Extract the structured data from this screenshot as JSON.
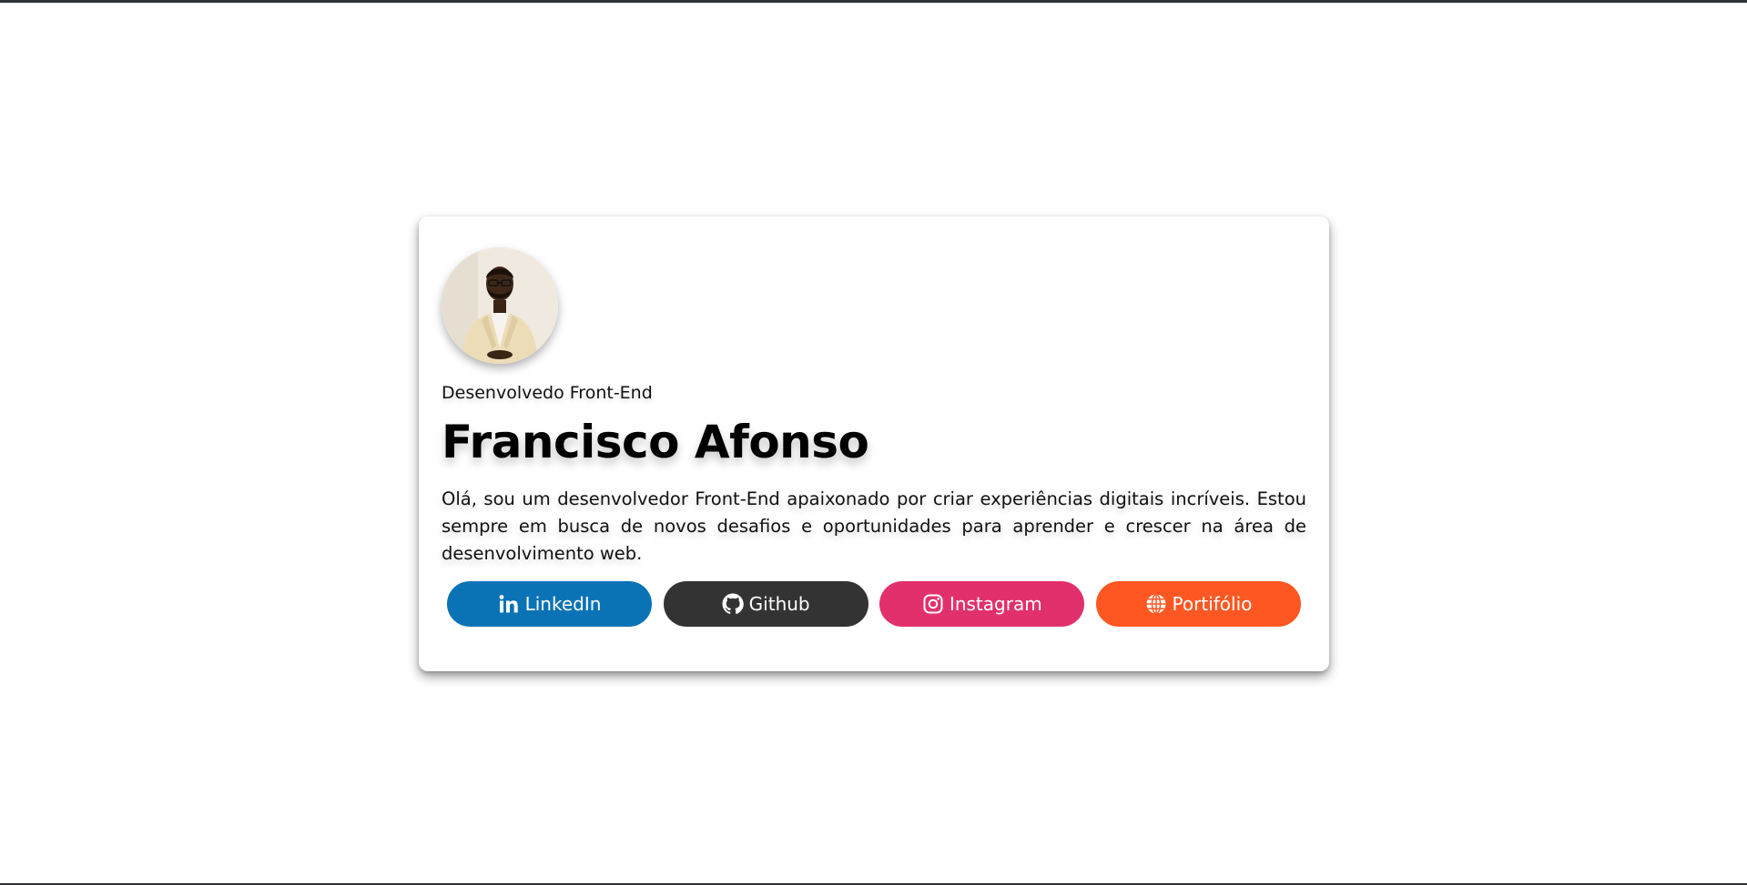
{
  "profile": {
    "role": "Desenvolvedo Front-End",
    "name": "Francisco Afonso",
    "bio": "Olá, sou um desenvolvedor Front-End apaixonado por criar experiências digitais incríveis. Estou sempre em busca de novos desafios e oportunidades para aprender e crescer na área de desenvolvimento web."
  },
  "links": [
    {
      "label": "LinkedIn",
      "icon": "linkedin-icon",
      "color": "#0a73b6"
    },
    {
      "label": "Github",
      "icon": "github-icon",
      "color": "#333333"
    },
    {
      "label": "Instagram",
      "icon": "instagram-icon",
      "color": "#e2306c"
    },
    {
      "label": "Portifólio",
      "icon": "globe-icon",
      "color": "#ff5722"
    }
  ]
}
